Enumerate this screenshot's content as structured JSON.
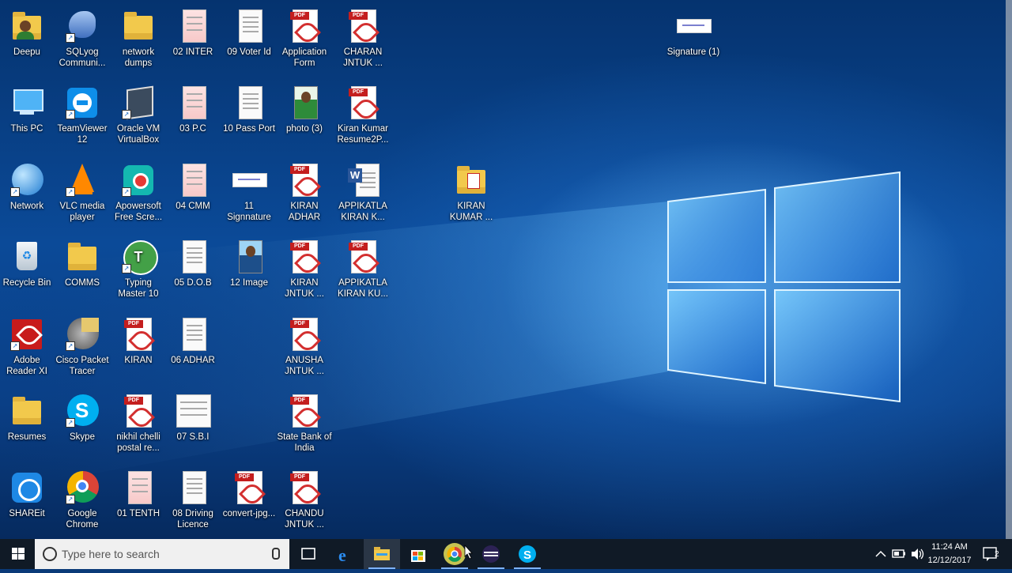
{
  "desktop": {
    "icons": [
      {
        "label": "Deepu",
        "type": "folder-user"
      },
      {
        "label": "SQLyog Communi...",
        "type": "dolphin"
      },
      {
        "label": "network dumps",
        "type": "folder"
      },
      {
        "label": "02 INTER",
        "type": "paper-pink"
      },
      {
        "label": "09 Voter Id",
        "type": "paper"
      },
      {
        "label": "Application Form",
        "type": "pdf"
      },
      {
        "label": "CHARAN JNTUK ...",
        "type": "pdf"
      },
      {
        "label": "This PC",
        "type": "pc"
      },
      {
        "label": "TeamViewer 12",
        "type": "teamviewer"
      },
      {
        "label": "Oracle VM VirtualBox",
        "type": "virtualbox"
      },
      {
        "label": "03 P.C",
        "type": "paper-pink"
      },
      {
        "label": "10 Pass Port",
        "type": "paper"
      },
      {
        "label": "photo (3)",
        "type": "photo-green"
      },
      {
        "label": "Kiran Kumar Resume2P...",
        "type": "pdf"
      },
      {
        "label": "Network",
        "type": "network"
      },
      {
        "label": "VLC media player",
        "type": "vlc"
      },
      {
        "label": "Apowersoft Free Scre...",
        "type": "apowersoft"
      },
      {
        "label": "04 CMM",
        "type": "paper-pink"
      },
      {
        "label": "11 Signnature",
        "type": "wide"
      },
      {
        "label": "KIRAN ADHAR",
        "type": "pdf"
      },
      {
        "label": "APPIKATLA KIRAN K...",
        "type": "word"
      },
      {
        "label": "KIRAN KUMAR ...",
        "type": "folder-pdf"
      },
      {
        "label": "Recycle Bin",
        "type": "recycle"
      },
      {
        "label": "COMMS",
        "type": "folder"
      },
      {
        "label": "Typing Master 10",
        "type": "typing"
      },
      {
        "label": "05 D.O.B",
        "type": "paper"
      },
      {
        "label": "12 Image",
        "type": "photo-blue"
      },
      {
        "label": "KIRAN JNTUK ...",
        "type": "pdf"
      },
      {
        "label": "APPIKATLA KIRAN KU...",
        "type": "pdf"
      },
      {
        "label": "Adobe Reader XI",
        "type": "adobe"
      },
      {
        "label": "Cisco Packet Tracer",
        "type": "cisco"
      },
      {
        "label": "KIRAN",
        "type": "pdf"
      },
      {
        "label": "06 ADHAR",
        "type": "paper"
      },
      {
        "label": "ANUSHA JNTUK ...",
        "type": "pdf"
      },
      {
        "label": "Resumes",
        "type": "folder"
      },
      {
        "label": "Skype",
        "type": "skype"
      },
      {
        "label": "nikhil chelli postal re...",
        "type": "pdf"
      },
      {
        "label": "07 S.B.I",
        "type": "paper-wide"
      },
      {
        "label": "State Bank of India",
        "type": "pdf"
      },
      {
        "label": "SHAREit",
        "type": "shareit"
      },
      {
        "label": "Google Chrome",
        "type": "chrome"
      },
      {
        "label": "01 TENTH",
        "type": "paper-pink"
      },
      {
        "label": "08 Driving Licence",
        "type": "paper"
      },
      {
        "label": "convert-jpg...",
        "type": "pdf"
      },
      {
        "label": "CHANDU JNTUK ...",
        "type": "pdf"
      },
      {
        "label": "Signature (1)",
        "type": "wide"
      }
    ]
  },
  "taskbar": {
    "search_placeholder": "Type here to search",
    "pinned": [
      "task-view",
      "edge",
      "file-explorer",
      "store",
      "chrome",
      "eclipse",
      "skype"
    ],
    "clock_time": "11:24 AM",
    "clock_date": "12/12/2017",
    "notification_count": "2"
  },
  "colors": {
    "taskbar": "#101a26",
    "accent": "#7fb3ff"
  }
}
